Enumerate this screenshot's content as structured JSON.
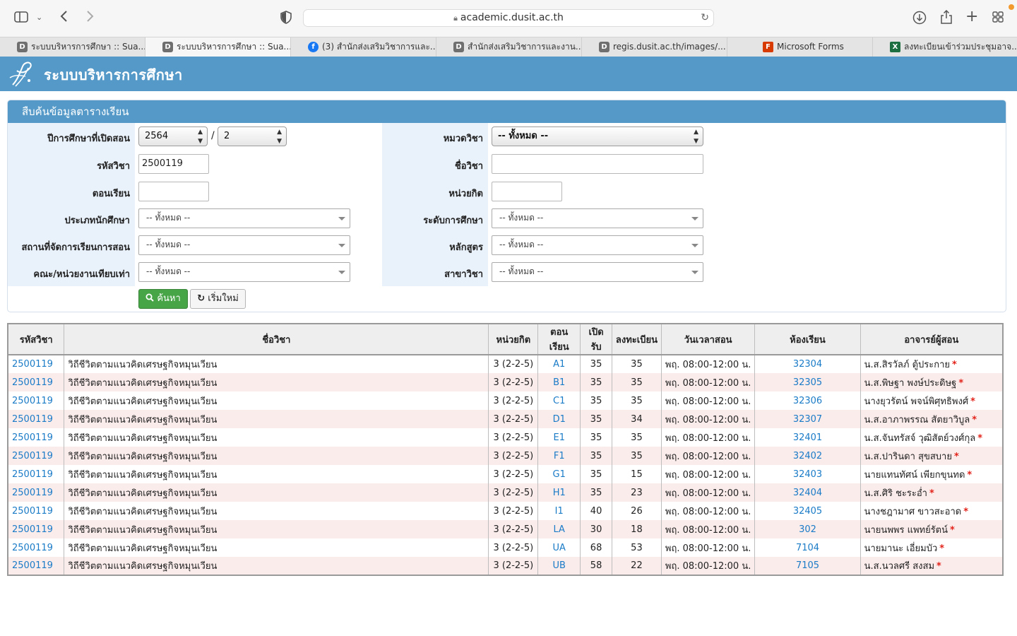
{
  "browser": {
    "url": "academic.dusit.ac.th",
    "tabs": [
      {
        "label": "ระบบบริหารการศึกษา :: Sua...",
        "favicon": "D",
        "active": false
      },
      {
        "label": "ระบบบริหารการศึกษา :: Sua...",
        "favicon": "D",
        "active": true
      },
      {
        "label": "(3) สำนักส่งเสริมวิชาการและ...",
        "favicon": "f",
        "active": false
      },
      {
        "label": "สำนักส่งเสริมวิชาการและงาน...",
        "favicon": "D",
        "active": false
      },
      {
        "label": "regis.dusit.ac.th/images/...",
        "favicon": "D",
        "active": false
      },
      {
        "label": "Microsoft Forms",
        "favicon": "ms",
        "active": false
      },
      {
        "label": "ลงทะเบียนเข้าร่วมประชุมอาจ...",
        "favicon": "xl",
        "active": false
      }
    ]
  },
  "site": {
    "title": "ระบบบริหารการศึกษา",
    "header_color": "#5499c7"
  },
  "search": {
    "panel_title": "สืบค้นข้อมูลตารางเรียน",
    "year_label": "ปีการศึกษาที่เปิดสอน",
    "year_value": "2564",
    "semester_value": "2",
    "course_code_label": "รหัสวิชา",
    "course_code_value": "2500119",
    "section_label": "ตอนเรียน",
    "section_value": "",
    "student_type_label": "ประเภทนักศึกษา",
    "student_type_value": "-- ทั้งหมด --",
    "location_label": "สถานที่จัดการเรียนการสอน",
    "location_value": "-- ทั้งหมด --",
    "faculty_label": "คณะ/หน่วยงานเทียบเท่า",
    "faculty_value": "-- ทั้งหมด --",
    "category_label": "หมวดวิชา",
    "category_value": "-- ทั้งหมด --",
    "course_name_label": "ชื่อวิชา",
    "course_name_value": "",
    "credits_label": "หน่วยกิต",
    "credits_value": "",
    "level_label": "ระดับการศึกษา",
    "level_value": "-- ทั้งหมด --",
    "curriculum_label": "หลักสูตร",
    "curriculum_value": "-- ทั้งหมด --",
    "major_label": "สาขาวิชา",
    "major_value": "-- ทั้งหมด --",
    "search_button": "ค้นหา",
    "reset_button": "เริ่มใหม่"
  },
  "table": {
    "headers": [
      "รหัสวิชา",
      "ชื่อวิชา",
      "หน่วยกิต",
      "ตอนเรียน",
      "เปิดรับ",
      "ลงทะเบียน",
      "วันเวลาสอน",
      "ห้องเรียน",
      "อาจารย์ผู้สอน"
    ],
    "rows": [
      {
        "code": "2500119",
        "name": "วิถีชีวิตตามแนวคิดเศรษฐกิจหมุนเวียน",
        "credits": "3 (2-2-5)",
        "section": "A1",
        "capacity": "35",
        "enrolled": "35",
        "time": "พฤ. 08:00-12:00 น.",
        "room": "32304",
        "teacher": "น.ส.สิรวัลภ์   ตู้ประกาย",
        "mark": "*"
      },
      {
        "code": "2500119",
        "name": "วิถีชีวิตตามแนวคิดเศรษฐกิจหมุนเวียน",
        "credits": "3 (2-2-5)",
        "section": "B1",
        "capacity": "35",
        "enrolled": "35",
        "time": "พฤ. 08:00-12:00 น.",
        "room": "32305",
        "teacher": "น.ส.พิษฐา   พงษ์ประดิษฐ",
        "mark": "*"
      },
      {
        "code": "2500119",
        "name": "วิถีชีวิตตามแนวคิดเศรษฐกิจหมุนเวียน",
        "credits": "3 (2-2-5)",
        "section": "C1",
        "capacity": "35",
        "enrolled": "35",
        "time": "พฤ. 08:00-12:00 น.",
        "room": "32306",
        "teacher": "นางยุวรัตน์   พจน์พิศุทธิพงศ์",
        "mark": "*"
      },
      {
        "code": "2500119",
        "name": "วิถีชีวิตตามแนวคิดเศรษฐกิจหมุนเวียน",
        "credits": "3 (2-2-5)",
        "section": "D1",
        "capacity": "35",
        "enrolled": "34",
        "time": "พฤ. 08:00-12:00 น.",
        "room": "32307",
        "teacher": "น.ส.อาภาพรรณ   สัตยาวิบูล",
        "mark": "*"
      },
      {
        "code": "2500119",
        "name": "วิถีชีวิตตามแนวคิดเศรษฐกิจหมุนเวียน",
        "credits": "3 (2-2-5)",
        "section": "E1",
        "capacity": "35",
        "enrolled": "35",
        "time": "พฤ. 08:00-12:00 น.",
        "room": "32401",
        "teacher": "น.ส.จันทรัสจ์   วุฒิสัตย์วงศ์กุล",
        "mark": "*"
      },
      {
        "code": "2500119",
        "name": "วิถีชีวิตตามแนวคิดเศรษฐกิจหมุนเวียน",
        "credits": "3 (2-2-5)",
        "section": "F1",
        "capacity": "35",
        "enrolled": "35",
        "time": "พฤ. 08:00-12:00 น.",
        "room": "32402",
        "teacher": "น.ส.ปารินดา   สุขสบาย",
        "mark": "*"
      },
      {
        "code": "2500119",
        "name": "วิถีชีวิตตามแนวคิดเศรษฐกิจหมุนเวียน",
        "credits": "3 (2-2-5)",
        "section": "G1",
        "capacity": "35",
        "enrolled": "15",
        "time": "พฤ. 08:00-12:00 น.",
        "room": "32403",
        "teacher": "นายแทนทัศน์   เพียกขุนทด",
        "mark": "*"
      },
      {
        "code": "2500119",
        "name": "วิถีชีวิตตามแนวคิดเศรษฐกิจหมุนเวียน",
        "credits": "3 (2-2-5)",
        "section": "H1",
        "capacity": "35",
        "enrolled": "23",
        "time": "พฤ. 08:00-12:00 น.",
        "room": "32404",
        "teacher": "น.ส.ศิริ   ชะระอ่ำ",
        "mark": "*"
      },
      {
        "code": "2500119",
        "name": "วิถีชีวิตตามแนวคิดเศรษฐกิจหมุนเวียน",
        "credits": "3 (2-2-5)",
        "section": "I1",
        "capacity": "40",
        "enrolled": "26",
        "time": "พฤ. 08:00-12:00 น.",
        "room": "32405",
        "teacher": "นางชฎามาศ   ขาวสะอาด",
        "mark": "*"
      },
      {
        "code": "2500119",
        "name": "วิถีชีวิตตามแนวคิดเศรษฐกิจหมุนเวียน",
        "credits": "3 (2-2-5)",
        "section": "LA",
        "capacity": "30",
        "enrolled": "18",
        "time": "พฤ. 08:00-12:00 น.",
        "room": "302",
        "teacher": "นายนพพร   แพทย์รัตน์",
        "mark": "*"
      },
      {
        "code": "2500119",
        "name": "วิถีชีวิตตามแนวคิดเศรษฐกิจหมุนเวียน",
        "credits": "3 (2-2-5)",
        "section": "UA",
        "capacity": "68",
        "enrolled": "53",
        "time": "พฤ. 08:00-12:00 น.",
        "room": "7104",
        "teacher": "นายมานะ   เอี่ยมบัว",
        "mark": "*"
      },
      {
        "code": "2500119",
        "name": "วิถีชีวิตตามแนวคิดเศรษฐกิจหมุนเวียน",
        "credits": "3 (2-2-5)",
        "section": "UB",
        "capacity": "58",
        "enrolled": "22",
        "time": "พฤ. 08:00-12:00 น.",
        "room": "7105",
        "teacher": "น.ส.นวลศรี   สงสม",
        "mark": "*"
      }
    ]
  }
}
